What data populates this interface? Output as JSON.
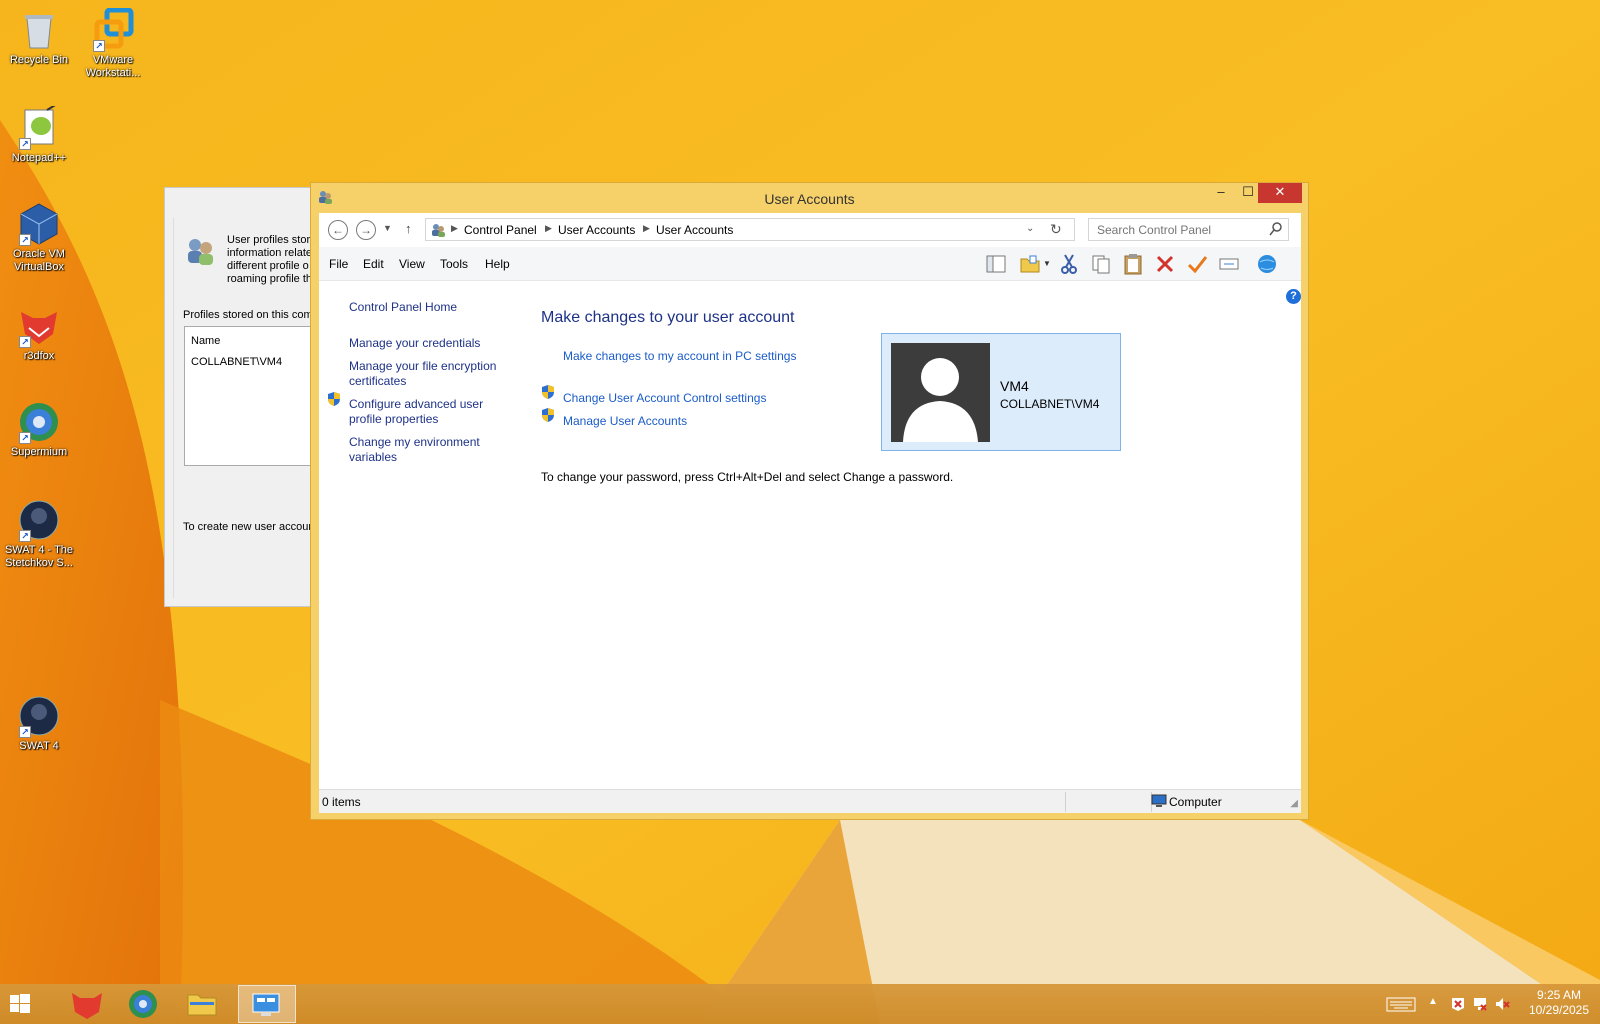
{
  "desktop": {
    "icons": [
      {
        "label": "Recycle Bin",
        "icon": "recycle-bin-icon"
      },
      {
        "label": "VMware Workstati...",
        "icon": "vmware-icon"
      },
      {
        "label": "Notepad++",
        "icon": "notepad-plus-plus-icon"
      },
      {
        "label": "Oracle VM VirtualBox",
        "icon": "virtualbox-icon"
      },
      {
        "label": "r3dfox",
        "icon": "r3dfox-icon"
      },
      {
        "label": "Supermium",
        "icon": "supermium-icon"
      },
      {
        "label": "SWAT 4 - The Stetchkov S...",
        "icon": "swat4-icon"
      },
      {
        "label": "SWAT 4",
        "icon": "swat4-icon"
      }
    ]
  },
  "profiles_dialog": {
    "description_lines": [
      "User profiles stor",
      "information relate",
      "different profile o",
      "roaming profile th"
    ],
    "profiles_label": "Profiles stored on this com",
    "list_header": "Name",
    "list_item": "COLLABNET\\VM4",
    "create_label": "To create new user accour"
  },
  "window": {
    "title": "User Accounts",
    "minimize_label": "–",
    "maximize_label": "☐",
    "close_label": "✕",
    "breadcrumbs": [
      "Control Panel",
      "User Accounts",
      "User Accounts"
    ],
    "search_placeholder": "Search Control Panel",
    "menu": [
      "File",
      "Edit",
      "View",
      "Tools",
      "Help"
    ],
    "toolbar_icons": [
      "layout-icon",
      "folder-options-icon",
      "cut-icon",
      "copy-icon",
      "paste-icon",
      "delete-icon",
      "properties-check-icon",
      "rename-icon",
      "network-globe-icon"
    ],
    "tasks": {
      "home": "Control Panel Home",
      "credentials": "Manage your credentials",
      "encryption": "Manage your file encryption certificates",
      "advanced_profile": "Configure advanced user profile properties",
      "environment": "Change my environment variables"
    },
    "content": {
      "title": "Make changes to your user account",
      "pc_settings_link": "Make changes to my account in PC settings",
      "uac_link": "Change User Account Control settings",
      "manage_link": "Manage User Accounts",
      "password_hint": "To change your password, press Ctrl+Alt+Del and select Change a password."
    },
    "account": {
      "name": "VM4",
      "domain": "COLLABNET\\VM4"
    },
    "status": {
      "items": "0 items",
      "location": "Computer"
    }
  },
  "taskbar": {
    "apps": [
      "start-icon",
      "r3dfox-icon",
      "supermium-icon",
      "file-explorer-icon",
      "control-panel-icon"
    ],
    "clock_time": "9:25 AM",
    "clock_date": "10/29/2025"
  },
  "colors": {
    "accent_blue": "#1e3287",
    "link_blue": "#1a5cc8",
    "close_red": "#c7372f",
    "tile_bg": "#dcecfb"
  }
}
